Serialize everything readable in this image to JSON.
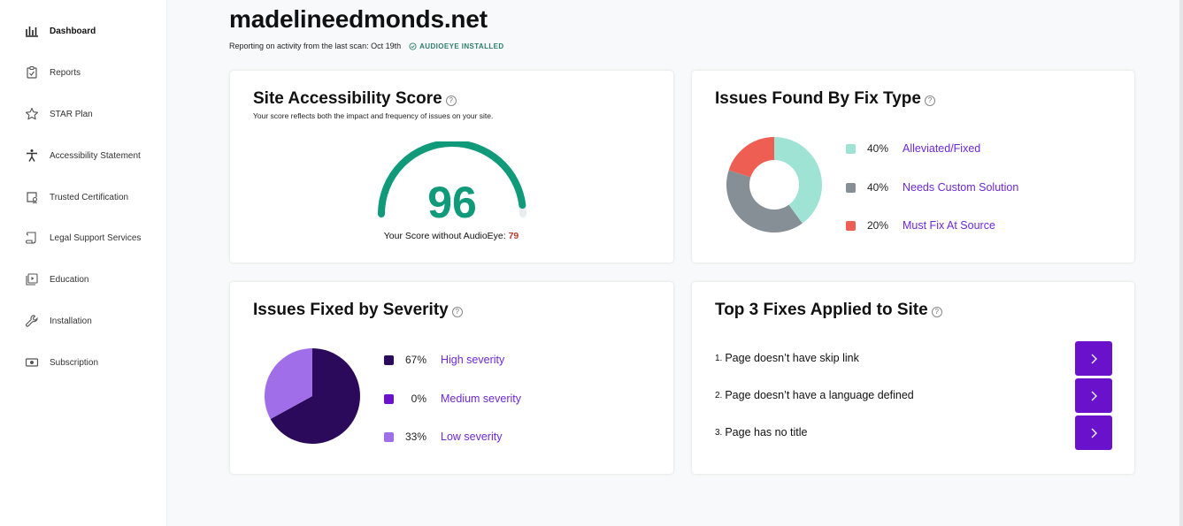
{
  "sidebar": {
    "items": [
      {
        "label": "Dashboard",
        "icon": "bar-chart-icon"
      },
      {
        "label": "Reports",
        "icon": "clipboard-icon"
      },
      {
        "label": "STAR Plan",
        "icon": "star-icon"
      },
      {
        "label": "Accessibility Statement",
        "icon": "person-icon"
      },
      {
        "label": "Trusted Certification",
        "icon": "certificate-icon"
      },
      {
        "label": "Legal Support Services",
        "icon": "scroll-icon"
      },
      {
        "label": "Education",
        "icon": "play-box-icon"
      },
      {
        "label": "Installation",
        "icon": "wrench-icon"
      },
      {
        "label": "Subscription",
        "icon": "money-icon"
      }
    ]
  },
  "header": {
    "site": "madelineedmonds.net",
    "report": "Reporting on activity from the last scan: Oct 19th",
    "installed": "AUDIOEYE INSTALLED"
  },
  "score_card": {
    "title": "Site Accessibility Score",
    "subtitle": "Your score reflects both the impact and frequency of issues on your site.",
    "score": "96",
    "score_fraction": 0.96,
    "without_label": "Your Score without AudioEye:",
    "without_value": "79",
    "color": "#119a7a"
  },
  "fix_type_card": {
    "title": "Issues Found By Fix Type",
    "items": [
      {
        "pct": "40%",
        "label": "Alleviated/Fixed",
        "color": "#9ee3d3",
        "value": 40
      },
      {
        "pct": "40%",
        "label": "Needs Custom Solution",
        "color": "#868e96",
        "value": 40
      },
      {
        "pct": "20%",
        "label": "Must Fix At Source",
        "color": "#ee5e52",
        "value": 20
      }
    ]
  },
  "severity_card": {
    "title": "Issues Fixed by Severity",
    "items": [
      {
        "pct": "67%",
        "label": "High severity",
        "color": "#2b0a5c",
        "value": 67
      },
      {
        "pct": "0%",
        "label": "Medium severity",
        "color": "#6a11cb",
        "value": 0
      },
      {
        "pct": "33%",
        "label": "Low severity",
        "color": "#9f6ee8",
        "value": 33
      }
    ]
  },
  "top_fixes_card": {
    "title": "Top 3 Fixes Applied to Site",
    "items": [
      {
        "num": "1.",
        "text": "Page doesn’t have skip link"
      },
      {
        "num": "2.",
        "text": "Page doesn’t have a language defined"
      },
      {
        "num": "3.",
        "text": "Page has no title"
      }
    ]
  }
}
